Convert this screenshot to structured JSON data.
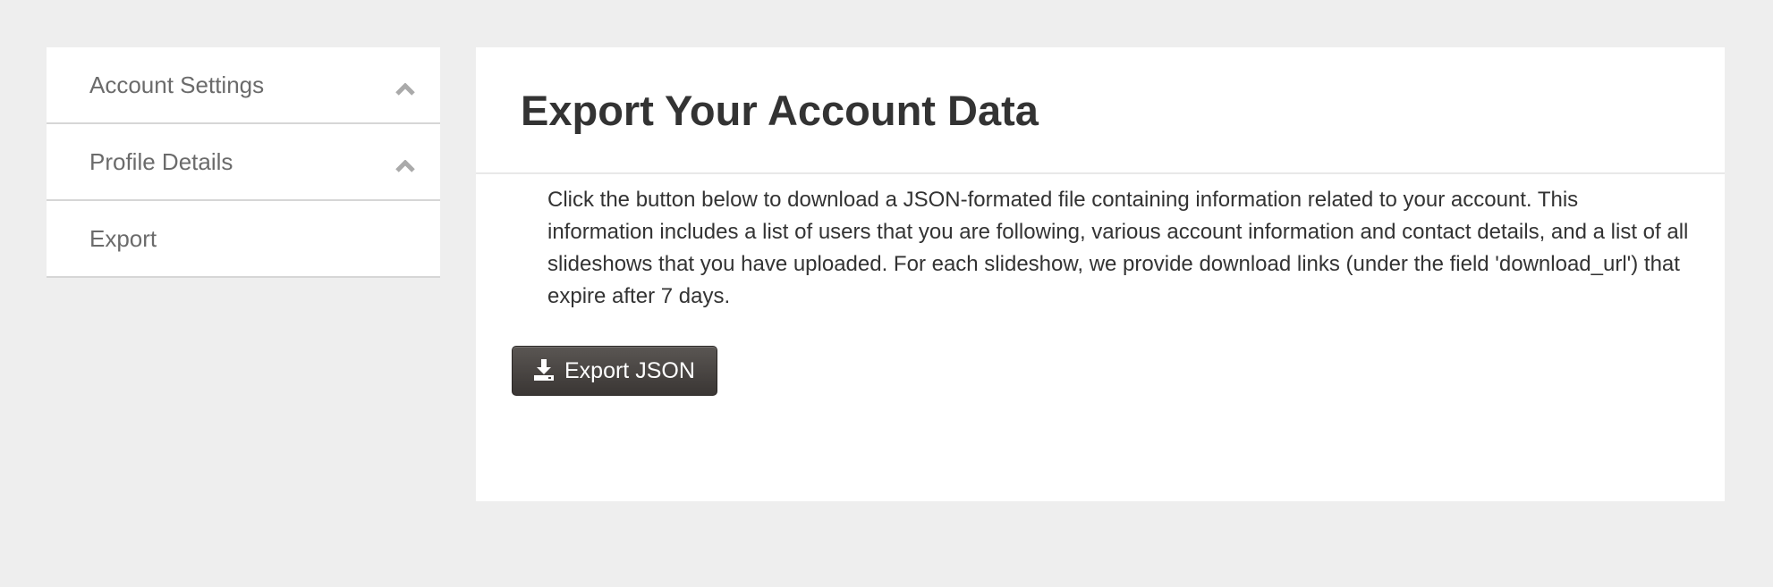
{
  "sidebar": {
    "items": [
      {
        "label": "Account Settings",
        "icon": "chevron-up-icon"
      },
      {
        "label": "Profile Details",
        "icon": "chevron-up-icon"
      },
      {
        "label": "Export"
      }
    ]
  },
  "main": {
    "title": "Export Your Account Data",
    "description": "Click the button below to download a JSON-formated file containing information related to your account. This information includes a list of users that you are following, various account information and contact details, and a list of all slideshows that you have uploaded. For each slideshow, we provide download links (under the field 'download_url') that expire after 7 days.",
    "export_button": {
      "label": "Export JSON",
      "icon": "download-icon"
    }
  },
  "colors": {
    "page_background": "#eeeeee",
    "panel_background": "#ffffff",
    "button_background": "#4a4644",
    "text_dark": "#333333",
    "text_muted": "#6b6b6b"
  }
}
